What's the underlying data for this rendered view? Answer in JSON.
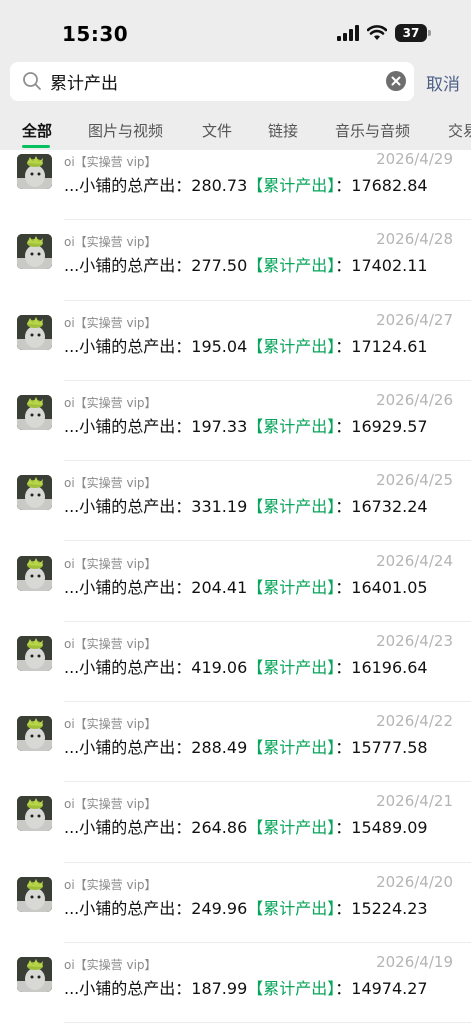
{
  "status_bar": {
    "time": "15:30",
    "battery": "37"
  },
  "search": {
    "query": "累计产出",
    "cancel_label": "取消"
  },
  "tabs": [
    {
      "label": "全部",
      "active": true
    },
    {
      "label": "图片与视频",
      "active": false
    },
    {
      "label": "文件",
      "active": false
    },
    {
      "label": "链接",
      "active": false
    },
    {
      "label": "音乐与音频",
      "active": false
    },
    {
      "label": "交易",
      "active": false
    }
  ],
  "results": [
    {
      "sender": "oi【实操营 vip】",
      "date": "2026/4/29",
      "prefix": "...小铺的总产出：",
      "amount": "280.73",
      "highlight": "【累计产出】",
      "total": "：17682.84"
    },
    {
      "sender": "oi【实操营 vip】",
      "date": "2026/4/28",
      "prefix": "...小铺的总产出：",
      "amount": "277.50",
      "highlight": "【累计产出】",
      "total": "：17402.11"
    },
    {
      "sender": "oi【实操营 vip】",
      "date": "2026/4/27",
      "prefix": "...小铺的总产出：",
      "amount": "195.04",
      "highlight": "【累计产出】",
      "total": "：17124.61"
    },
    {
      "sender": "oi【实操营 vip】",
      "date": "2026/4/26",
      "prefix": "...小铺的总产出：",
      "amount": "197.33",
      "highlight": "【累计产出】",
      "total": "：16929.57"
    },
    {
      "sender": "oi【实操营 vip】",
      "date": "2026/4/25",
      "prefix": "...小铺的总产出：",
      "amount": "331.19",
      "highlight": "【累计产出】",
      "total": "：16732.24"
    },
    {
      "sender": "oi【实操营 vip】",
      "date": "2026/4/24",
      "prefix": "...小铺的总产出：",
      "amount": "204.41",
      "highlight": "【累计产出】",
      "total": "：16401.05"
    },
    {
      "sender": "oi【实操营 vip】",
      "date": "2026/4/23",
      "prefix": "...小铺的总产出：",
      "amount": "419.06",
      "highlight": "【累计产出】",
      "total": "：16196.64"
    },
    {
      "sender": "oi【实操营 vip】",
      "date": "2026/4/22",
      "prefix": "...小铺的总产出：",
      "amount": "288.49",
      "highlight": "【累计产出】",
      "total": "：15777.58"
    },
    {
      "sender": "oi【实操营 vip】",
      "date": "2026/4/21",
      "prefix": "...小铺的总产出：",
      "amount": "264.86",
      "highlight": "【累计产出】",
      "total": "：15489.09"
    },
    {
      "sender": "oi【实操营 vip】",
      "date": "2026/4/20",
      "prefix": "...小铺的总产出：",
      "amount": "249.96",
      "highlight": "【累计产出】",
      "total": "：15224.23"
    },
    {
      "sender": "oi【实操营 vip】",
      "date": "2026/4/19",
      "prefix": "...小铺的总产出：",
      "amount": "187.99",
      "highlight": "【累计产出】",
      "total": "：14974.27"
    }
  ],
  "colors": {
    "accent": "#07c160",
    "highlight": "#07a55a",
    "link": "#4e5f87",
    "header_bg": "#ededed"
  },
  "icons": [
    "signal-icon",
    "wifi-icon",
    "battery-icon",
    "search-icon",
    "clear-icon",
    "avatar-image"
  ]
}
